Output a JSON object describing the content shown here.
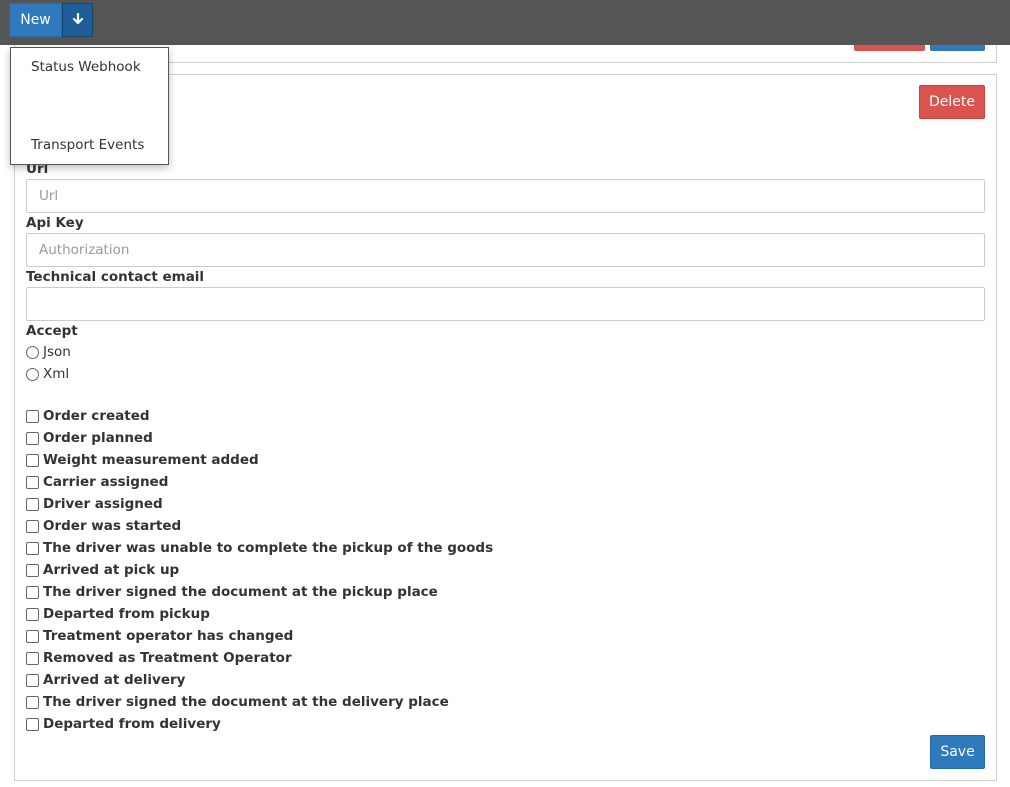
{
  "toolbar": {
    "new_label": "New",
    "dropdown_icon": "arrow-down-icon"
  },
  "dropdown_menu": {
    "items": [
      "Status Webhook",
      "Transport Events"
    ]
  },
  "panel": {
    "delete_label": "Delete",
    "save_label": "Save",
    "url": {
      "label": "Url",
      "value": "",
      "placeholder": "Url"
    },
    "api_key": {
      "label": "Api Key",
      "value": "",
      "placeholder": "Authorization"
    },
    "contact_email": {
      "label": "Technical contact email",
      "value": "",
      "placeholder": ""
    },
    "accept": {
      "label": "Accept",
      "options": [
        "Json",
        "Xml"
      ],
      "selected": null
    },
    "events": [
      "Order created",
      "Order planned",
      "Weight measurement added",
      "Carrier assigned",
      "Driver assigned",
      "Order was started",
      "The driver was unable to complete the pickup of the goods",
      "Arrived at pick up",
      "The driver signed the document at the pickup place",
      "Departed from pickup",
      "Treatment operator has changed",
      "Removed as Treatment Operator",
      "Arrived at delivery",
      "The driver signed the document at the delivery place",
      "Departed from delivery"
    ]
  },
  "colors": {
    "topbar": "#555555",
    "primary": "#2f79bd",
    "danger": "#d9534f"
  }
}
